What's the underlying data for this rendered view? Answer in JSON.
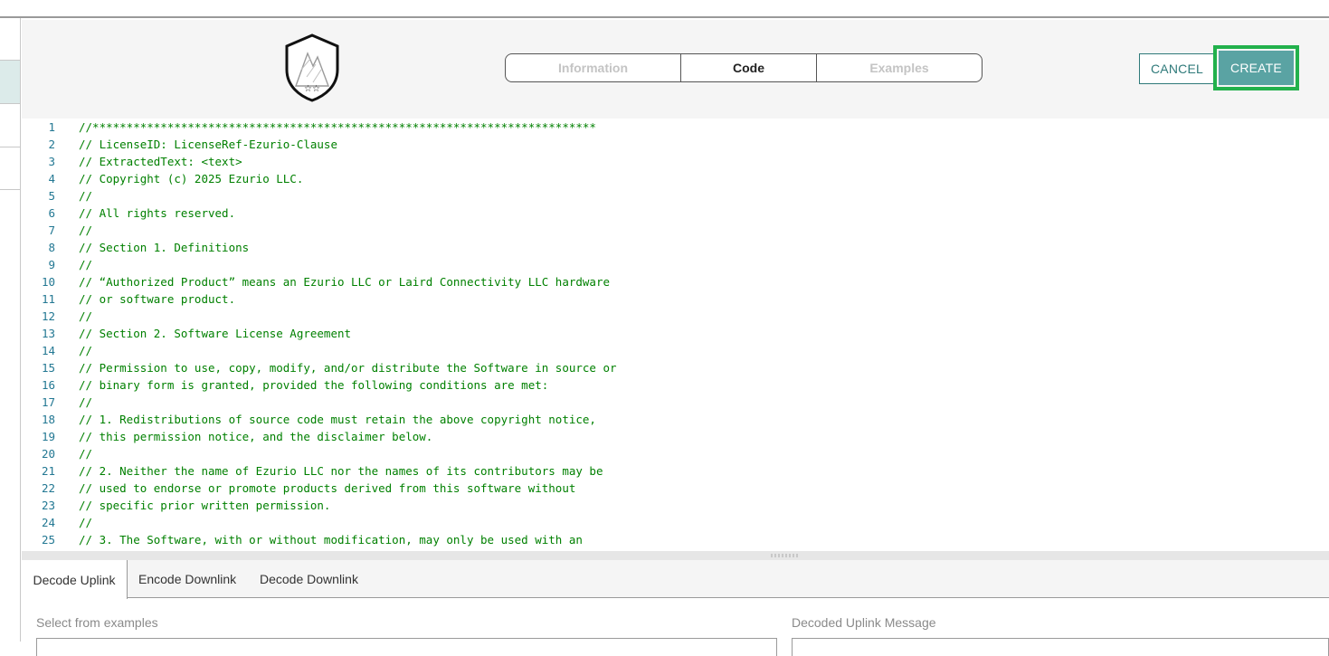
{
  "stepper": {
    "steps": [
      "Information",
      "Code",
      "Examples"
    ],
    "active": "Code"
  },
  "actions": {
    "cancel_label": "CANCEL",
    "create_label": "CREATE"
  },
  "colors": {
    "accent": "#5aa3a3",
    "highlight_border": "#22b14c",
    "comment_text": "#008000",
    "line_number": "#237893"
  },
  "editor": {
    "lines": [
      {
        "n": "1",
        "text": "//**************************************************************************"
      },
      {
        "n": "2",
        "text": "// LicenseID: LicenseRef-Ezurio-Clause"
      },
      {
        "n": "3",
        "text": "// ExtractedText: <text>"
      },
      {
        "n": "4",
        "text": "// Copyright (c) 2025 Ezurio LLC."
      },
      {
        "n": "5",
        "text": "//"
      },
      {
        "n": "6",
        "text": "// All rights reserved."
      },
      {
        "n": "7",
        "text": "//"
      },
      {
        "n": "8",
        "text": "// Section 1. Definitions"
      },
      {
        "n": "9",
        "text": "//"
      },
      {
        "n": "10",
        "text": "// “Authorized Product” means an Ezurio LLC or Laird Connectivity LLC hardware"
      },
      {
        "n": "11",
        "text": "// or software product."
      },
      {
        "n": "12",
        "text": "//"
      },
      {
        "n": "13",
        "text": "// Section 2. Software License Agreement"
      },
      {
        "n": "14",
        "text": "//"
      },
      {
        "n": "15",
        "text": "// Permission to use, copy, modify, and/or distribute the Software in source or"
      },
      {
        "n": "16",
        "text": "// binary form is granted, provided the following conditions are met:"
      },
      {
        "n": "17",
        "text": "//"
      },
      {
        "n": "18",
        "text": "// 1. Redistributions of source code must retain the above copyright notice,"
      },
      {
        "n": "19",
        "text": "// this permission notice, and the disclaimer below."
      },
      {
        "n": "20",
        "text": "//"
      },
      {
        "n": "21",
        "text": "// 2. Neither the name of Ezurio LLC nor the names of its contributors may be"
      },
      {
        "n": "22",
        "text": "// used to endorse or promote products derived from this software without"
      },
      {
        "n": "23",
        "text": "// specific prior written permission."
      },
      {
        "n": "24",
        "text": "//"
      },
      {
        "n": "25",
        "text": "// 3. The Software, with or without modification, may only be used with an"
      }
    ]
  },
  "bottom_tabs": [
    "Decode Uplink",
    "Encode Downlink",
    "Decode Downlink"
  ],
  "decode": {
    "examples_label": "Select from examples",
    "decoded_label": "Decoded Uplink Message"
  }
}
